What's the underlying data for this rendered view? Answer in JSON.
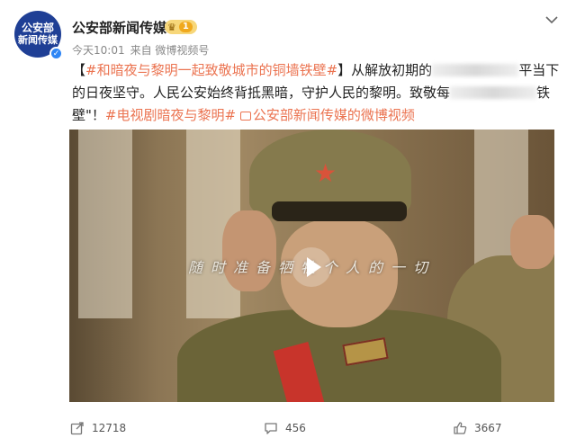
{
  "author": {
    "avatar_line1": "公安部",
    "avatar_line2": "新闻传媒",
    "name": "公安部新闻传媒",
    "badge_level": "1",
    "time": "今天10:01",
    "source": "来自 微博视频号"
  },
  "post": {
    "bracket_open": "【",
    "tag1": "#和暗夜与黎明一起致敬城市的铜墙铁壁#",
    "bracket_close": "】",
    "text1": "从解放初期的",
    "text2": "平当下的日夜坚守。人民公安始终背抵黑暗，守护人民的黎明。致敬每",
    "text3": "铁壁\"！",
    "tag2": "#电视剧暗夜与黎明#",
    "video_link": "公安部新闻传媒的微博视频"
  },
  "video": {
    "subtitle": "随时准备牺牲个人的一切"
  },
  "actions": {
    "share_count": "12718",
    "comment_count": "456",
    "like_count": "3667"
  },
  "colors": {
    "tag": "#eb7350",
    "avatar_bg": "#1f3f95",
    "verified": "#2e86f5"
  }
}
